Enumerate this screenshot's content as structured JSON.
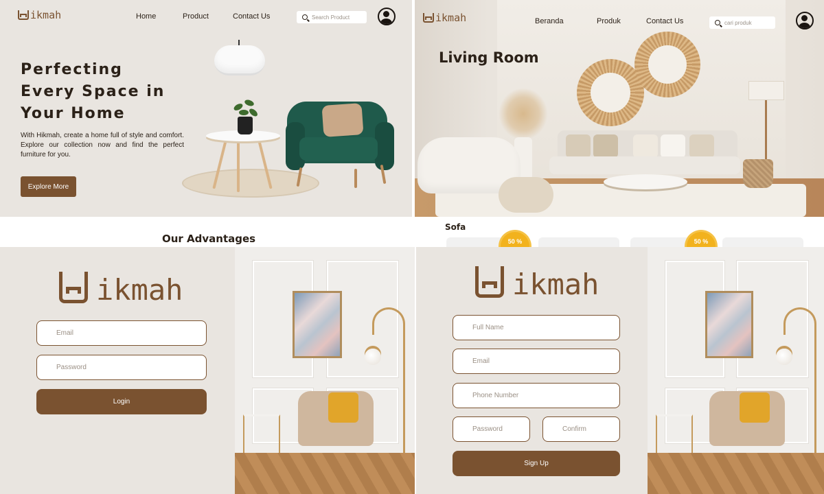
{
  "hero": {
    "brand": "ikmah",
    "nav": [
      "Home",
      "Product",
      "Contact Us"
    ],
    "search_placeholder": "Search Product",
    "title_lines": [
      "Perfecting",
      "Every Space in",
      "Your Home"
    ],
    "description": "With Hikmah, create a home full of style and comfort. Explore our collection now and find the perfect furniture for you.",
    "cta_label": "Explore More"
  },
  "living": {
    "brand": "ikmah",
    "nav": [
      "Beranda",
      "Produk",
      "Contact Us"
    ],
    "search_placeholder": "cari produk",
    "title": "Living Room"
  },
  "advantages": {
    "title": "Our Advantages"
  },
  "sofa_section": {
    "title": "Sofa",
    "badges": [
      "50 %",
      "50 %"
    ]
  },
  "login": {
    "brand": "ikmah",
    "email_placeholder": "Email",
    "password_placeholder": "Password",
    "submit_label": "Login"
  },
  "signup": {
    "brand": "ikmah",
    "fullname_placeholder": "Full Name",
    "email_placeholder": "Email",
    "phone_placeholder": "Phone Number",
    "password_placeholder": "Password",
    "confirm_placeholder": "Confirm",
    "submit_label": "Sign Up"
  },
  "colors": {
    "brand_brown": "#7a5230",
    "background_beige": "#e9e5e0",
    "chair_green": "#1f5a4b",
    "badge_yellow": "#f2b21d"
  }
}
